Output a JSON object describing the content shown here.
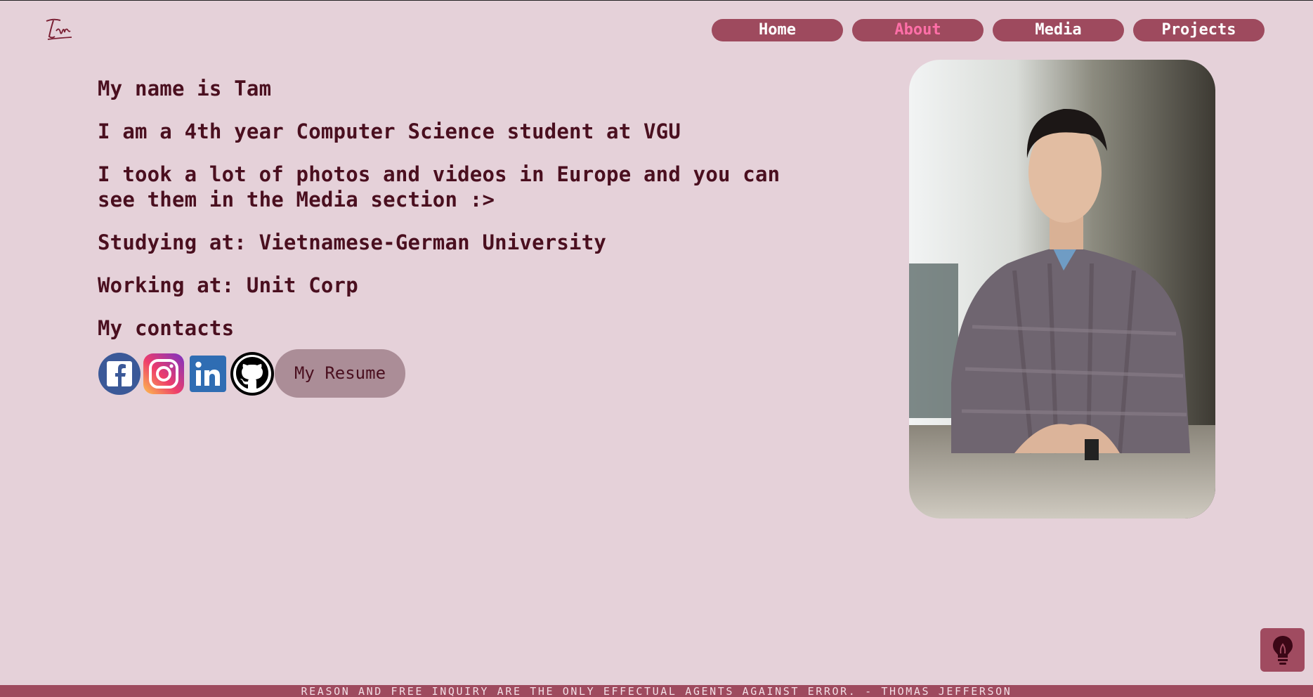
{
  "header": {
    "logo_text": "Tam",
    "nav": [
      {
        "label": "Home",
        "active": false
      },
      {
        "label": "About",
        "active": true
      },
      {
        "label": "Media",
        "active": false
      },
      {
        "label": "Projects",
        "active": false
      }
    ]
  },
  "about": {
    "name_line": "My name is Tam",
    "study_line": "I am a 4th year Computer Science student at VGU",
    "media_line": "I took a lot of photos and videos in Europe and you can see them in the Media section :>",
    "studying_line": "Studying at: Vietnamese-German University",
    "working_line": "Working at: Unit Corp",
    "contacts_heading": "My contacts",
    "socials": [
      {
        "icon": "facebook-icon",
        "color": "#3b5998"
      },
      {
        "icon": "instagram-icon",
        "color": "#d6249f"
      },
      {
        "icon": "linkedin-icon",
        "color": "#2f6db3"
      },
      {
        "icon": "github-icon",
        "color": "#000000"
      }
    ],
    "resume_label": "My Resume"
  },
  "photo": {
    "icon": "profile-photo"
  },
  "theme": {
    "background": "#e5d1d9",
    "accent": "#9e4a5e",
    "active_nav": "#ff6fa8",
    "text": "#4a0f1f"
  },
  "footer": {
    "quote": "REASON AND FREE INQUIRY ARE THE ONLY EFFECTUAL AGENTS AGAINST ERROR. - THOMAS JEFFERSON"
  }
}
